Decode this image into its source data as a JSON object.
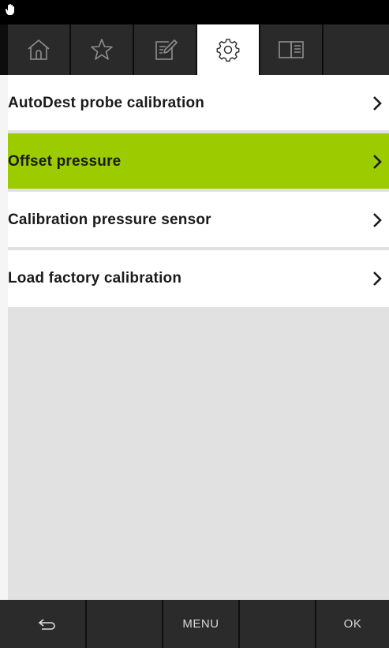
{
  "status_bar": {
    "indicator_icon": "hand-icon"
  },
  "tabs": [
    {
      "icon": "home-icon",
      "active": false
    },
    {
      "icon": "star-icon",
      "active": false
    },
    {
      "icon": "edit-icon",
      "active": false
    },
    {
      "icon": "gear-icon",
      "active": true
    },
    {
      "icon": "manual-icon",
      "active": false
    },
    {
      "icon": "",
      "active": false
    }
  ],
  "menu": {
    "items": [
      {
        "label": "AutoDest probe calibration",
        "selected": false
      },
      {
        "label": "Offset pressure",
        "selected": true
      },
      {
        "label": "Calibration pressure sensor",
        "selected": false
      },
      {
        "label": "Load factory calibration",
        "selected": false
      }
    ]
  },
  "bottom_bar": {
    "back_icon": "back-arrow-icon",
    "menu_label": "MENU",
    "ok_label": "OK"
  },
  "colors": {
    "selected": "#9ccc00",
    "tabbar": "#2a2a2a",
    "background": "#e1e1e1"
  }
}
